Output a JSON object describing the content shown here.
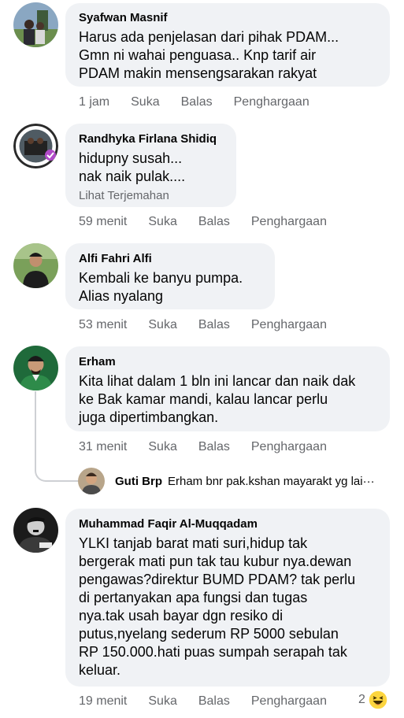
{
  "comments": [
    {
      "author": "Syafwan Masnif",
      "text": "Harus ada penjelasan dari pihak PDAM...\nGmn ni wahai penguasa.. Knp tarif air\nPDAM makin mensengsarakan rakyat",
      "time": "1 jam",
      "like": "Suka",
      "reply": "Balas",
      "award": "Penghargaan"
    },
    {
      "author": "Randhyka Firlana Shidiq",
      "text": "hidupny susah...\nnak naik pulak....",
      "translate": "Lihat Terjemahan",
      "time": "59 menit",
      "like": "Suka",
      "reply": "Balas",
      "award": "Penghargaan"
    },
    {
      "author": "Alfi Fahri Alfi",
      "text": "Kembali ke banyu pumpa.\nAlias nyalang",
      "time": "53 menit",
      "like": "Suka",
      "reply": "Balas",
      "award": "Penghargaan"
    },
    {
      "author": "Erham",
      "text": "Kita lihat dalam 1 bln ini lancar dan naik dak\nke Bak kamar mandi, kalau lancar perlu\njuga dipertimbangkan.",
      "time": "31 menit",
      "like": "Suka",
      "reply": "Balas",
      "award": "Penghargaan"
    },
    {
      "author": "Muhammad Faqir Al-Muqqadam",
      "text": "YLKI tanjab barat mati suri,hidup tak\nbergerak mati pun tak tau kubur nya.dewan\npengawas?direktur BUMD PDAM? tak perlu\ndi pertanyakan apa fungsi dan tugas\nnya.tak usah bayar dgn resiko di\nputus,nyelang sederum RP 5000 sebulan\nRP 150.000.hati puas sumpah serapah tak\nkeluar.",
      "time": "19 menit",
      "like": "Suka",
      "reply": "Balas",
      "award": "Penghargaan",
      "reaction_count": "2",
      "reaction_icon": "haha-emoji-icon"
    }
  ],
  "reply_preview": {
    "author": "Guti Brp",
    "text": "Erham bnr pak.kshan mayarakt yg lai",
    "more": "···"
  },
  "colors": {
    "bubble": "#f0f2f5",
    "meta": "#65676b",
    "text": "#050505",
    "thread": "#ced0d4"
  }
}
